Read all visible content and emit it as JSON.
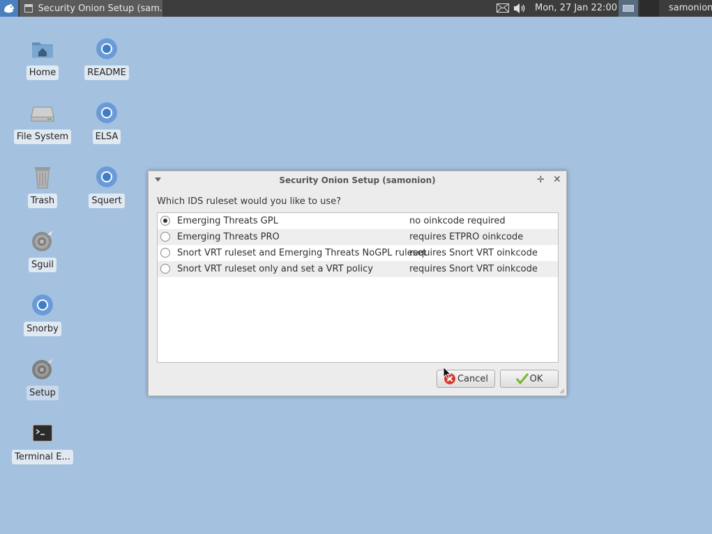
{
  "panel": {
    "task_title": "Security Onion Setup (sam...",
    "clock": "Mon, 27 Jan  22:00",
    "user": "samonion"
  },
  "desktop": {
    "icons": [
      {
        "label": "Home",
        "icon": "home-folder-icon"
      },
      {
        "label": "README",
        "icon": "chromium-icon"
      },
      {
        "label": "File System",
        "icon": "drive-icon"
      },
      {
        "label": "ELSA",
        "icon": "chromium-icon"
      },
      {
        "label": "Trash",
        "icon": "trash-icon"
      },
      {
        "label": "Squert",
        "icon": "chromium-icon"
      },
      {
        "label": "Sguil",
        "icon": "onion-icon"
      },
      {
        "label": "Snorby",
        "icon": "chromium-icon"
      },
      {
        "label": "Setup",
        "icon": "onion-icon"
      },
      {
        "label": "Terminal E...",
        "icon": "terminal-icon"
      }
    ]
  },
  "dialog": {
    "title": "Security Onion Setup (samonion)",
    "question": "Which IDS ruleset would you like to use?",
    "options": [
      {
        "name": "Emerging Threats GPL",
        "note": "no oinkcode required",
        "selected": true
      },
      {
        "name": "Emerging Threats PRO",
        "note": "requires ETPRO oinkcode",
        "selected": false
      },
      {
        "name": "Snort VRT ruleset and Emerging Threats NoGPL ruleset",
        "note": "requires Snort VRT oinkcode",
        "selected": false
      },
      {
        "name": "Snort VRT ruleset only and set a VRT policy",
        "note": "requires Snort VRT oinkcode",
        "selected": false
      }
    ],
    "cancel_label": "Cancel",
    "ok_label": "OK"
  },
  "colors": {
    "desktop_bg": "#a4c2df",
    "panel_bg": "#3c3c3c",
    "accent": "#4a7fc0"
  }
}
